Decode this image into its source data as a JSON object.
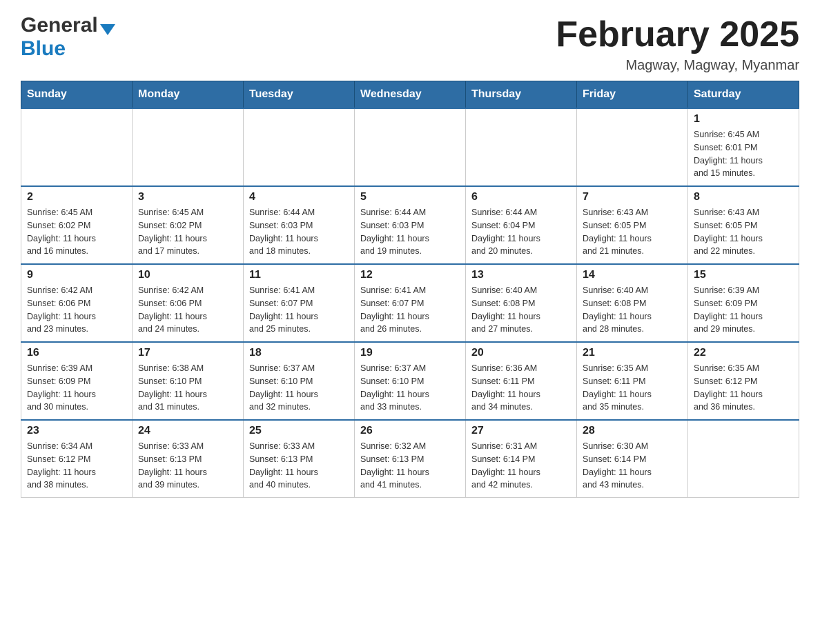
{
  "header": {
    "logo_general": "General",
    "logo_blue": "Blue",
    "month_title": "February 2025",
    "location": "Magway, Magway, Myanmar"
  },
  "days_of_week": [
    "Sunday",
    "Monday",
    "Tuesday",
    "Wednesday",
    "Thursday",
    "Friday",
    "Saturday"
  ],
  "weeks": [
    {
      "days": [
        {
          "number": "",
          "info": ""
        },
        {
          "number": "",
          "info": ""
        },
        {
          "number": "",
          "info": ""
        },
        {
          "number": "",
          "info": ""
        },
        {
          "number": "",
          "info": ""
        },
        {
          "number": "",
          "info": ""
        },
        {
          "number": "1",
          "info": "Sunrise: 6:45 AM\nSunset: 6:01 PM\nDaylight: 11 hours\nand 15 minutes."
        }
      ]
    },
    {
      "days": [
        {
          "number": "2",
          "info": "Sunrise: 6:45 AM\nSunset: 6:02 PM\nDaylight: 11 hours\nand 16 minutes."
        },
        {
          "number": "3",
          "info": "Sunrise: 6:45 AM\nSunset: 6:02 PM\nDaylight: 11 hours\nand 17 minutes."
        },
        {
          "number": "4",
          "info": "Sunrise: 6:44 AM\nSunset: 6:03 PM\nDaylight: 11 hours\nand 18 minutes."
        },
        {
          "number": "5",
          "info": "Sunrise: 6:44 AM\nSunset: 6:03 PM\nDaylight: 11 hours\nand 19 minutes."
        },
        {
          "number": "6",
          "info": "Sunrise: 6:44 AM\nSunset: 6:04 PM\nDaylight: 11 hours\nand 20 minutes."
        },
        {
          "number": "7",
          "info": "Sunrise: 6:43 AM\nSunset: 6:05 PM\nDaylight: 11 hours\nand 21 minutes."
        },
        {
          "number": "8",
          "info": "Sunrise: 6:43 AM\nSunset: 6:05 PM\nDaylight: 11 hours\nand 22 minutes."
        }
      ]
    },
    {
      "days": [
        {
          "number": "9",
          "info": "Sunrise: 6:42 AM\nSunset: 6:06 PM\nDaylight: 11 hours\nand 23 minutes."
        },
        {
          "number": "10",
          "info": "Sunrise: 6:42 AM\nSunset: 6:06 PM\nDaylight: 11 hours\nand 24 minutes."
        },
        {
          "number": "11",
          "info": "Sunrise: 6:41 AM\nSunset: 6:07 PM\nDaylight: 11 hours\nand 25 minutes."
        },
        {
          "number": "12",
          "info": "Sunrise: 6:41 AM\nSunset: 6:07 PM\nDaylight: 11 hours\nand 26 minutes."
        },
        {
          "number": "13",
          "info": "Sunrise: 6:40 AM\nSunset: 6:08 PM\nDaylight: 11 hours\nand 27 minutes."
        },
        {
          "number": "14",
          "info": "Sunrise: 6:40 AM\nSunset: 6:08 PM\nDaylight: 11 hours\nand 28 minutes."
        },
        {
          "number": "15",
          "info": "Sunrise: 6:39 AM\nSunset: 6:09 PM\nDaylight: 11 hours\nand 29 minutes."
        }
      ]
    },
    {
      "days": [
        {
          "number": "16",
          "info": "Sunrise: 6:39 AM\nSunset: 6:09 PM\nDaylight: 11 hours\nand 30 minutes."
        },
        {
          "number": "17",
          "info": "Sunrise: 6:38 AM\nSunset: 6:10 PM\nDaylight: 11 hours\nand 31 minutes."
        },
        {
          "number": "18",
          "info": "Sunrise: 6:37 AM\nSunset: 6:10 PM\nDaylight: 11 hours\nand 32 minutes."
        },
        {
          "number": "19",
          "info": "Sunrise: 6:37 AM\nSunset: 6:10 PM\nDaylight: 11 hours\nand 33 minutes."
        },
        {
          "number": "20",
          "info": "Sunrise: 6:36 AM\nSunset: 6:11 PM\nDaylight: 11 hours\nand 34 minutes."
        },
        {
          "number": "21",
          "info": "Sunrise: 6:35 AM\nSunset: 6:11 PM\nDaylight: 11 hours\nand 35 minutes."
        },
        {
          "number": "22",
          "info": "Sunrise: 6:35 AM\nSunset: 6:12 PM\nDaylight: 11 hours\nand 36 minutes."
        }
      ]
    },
    {
      "days": [
        {
          "number": "23",
          "info": "Sunrise: 6:34 AM\nSunset: 6:12 PM\nDaylight: 11 hours\nand 38 minutes."
        },
        {
          "number": "24",
          "info": "Sunrise: 6:33 AM\nSunset: 6:13 PM\nDaylight: 11 hours\nand 39 minutes."
        },
        {
          "number": "25",
          "info": "Sunrise: 6:33 AM\nSunset: 6:13 PM\nDaylight: 11 hours\nand 40 minutes."
        },
        {
          "number": "26",
          "info": "Sunrise: 6:32 AM\nSunset: 6:13 PM\nDaylight: 11 hours\nand 41 minutes."
        },
        {
          "number": "27",
          "info": "Sunrise: 6:31 AM\nSunset: 6:14 PM\nDaylight: 11 hours\nand 42 minutes."
        },
        {
          "number": "28",
          "info": "Sunrise: 6:30 AM\nSunset: 6:14 PM\nDaylight: 11 hours\nand 43 minutes."
        },
        {
          "number": "",
          "info": ""
        }
      ]
    }
  ]
}
